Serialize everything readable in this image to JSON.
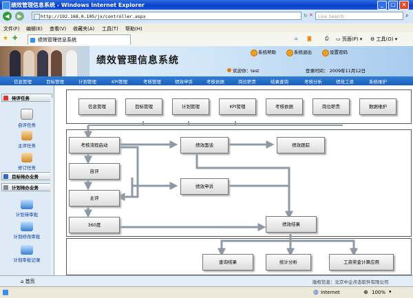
{
  "window": {
    "title": "绩效管理信息系统 - Windows Internet Explorer"
  },
  "addressbar": {
    "url": "http://192.168.0.105/jx/controller.aspx",
    "search_placeholder": "Live Search"
  },
  "menubar": {
    "items": [
      "文件(F)",
      "编辑(E)",
      "查看(V)",
      "收藏夹(A)",
      "工具(T)",
      "帮助(H)"
    ]
  },
  "favbar": {
    "tab_label": "绩效管理信息系统",
    "page_label": "页面(P)",
    "tools_label": "工具(O)"
  },
  "header": {
    "title": "绩效管理信息系统",
    "buttons": [
      "系统帮助",
      "系统退出",
      "设置密码"
    ],
    "welcome": "欢迎你：test",
    "login_time": "登录时间： 2009年11月12日"
  },
  "nav": {
    "items": [
      "信息管理",
      "目标管理",
      "计划管理",
      "KPI管理",
      "考核管理",
      "绩效申诉",
      "考核依据",
      "岗位职责",
      "结果查询",
      "考核分析",
      "绩效工资",
      "系统维护"
    ]
  },
  "sidebar": {
    "sections": [
      "待评任务",
      "目标待办业务",
      "计划待办业务"
    ],
    "todo_items": [
      "自评任务",
      "主评任务",
      "修订任务"
    ],
    "plan_items": [
      "计划待审批",
      "计划修改审批",
      "计划审批记录"
    ]
  },
  "flow": {
    "top_row": [
      "信息管理",
      "目标管理",
      "计划管理",
      "KPI管理",
      "考核依据",
      "岗位职责",
      "数据维护"
    ],
    "start": "考核流程启动",
    "interview": "绩效面谈",
    "tracking": "绩效跟踪",
    "self_eval": "自评",
    "main_eval": "主评",
    "appeal": "绩效申诉",
    "deg360": "360度",
    "result": "绩效结果",
    "bottom_row": [
      "查询结果",
      "统计分析",
      "工资奖金计算应用"
    ]
  },
  "footer": {
    "home": "首页",
    "copyright": "版权信息：北京中企点击软件有限公司"
  },
  "statusbar": {
    "zone": "Internet",
    "zoom": "100%"
  }
}
